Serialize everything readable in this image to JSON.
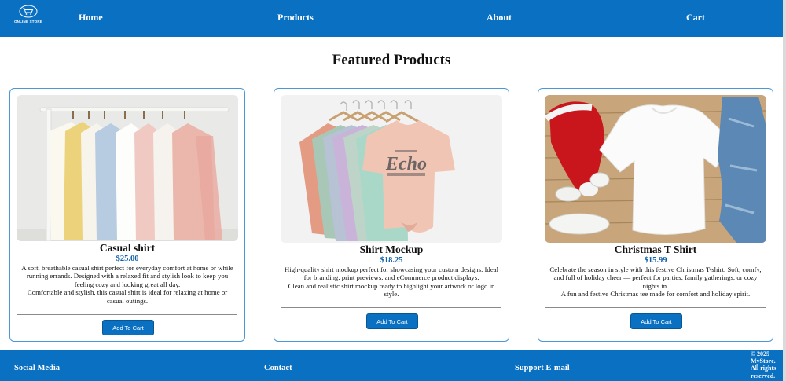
{
  "nav": {
    "logo_text": "ONLINE STORE",
    "links": [
      "Home",
      "Products",
      "About",
      "Cart"
    ]
  },
  "main": {
    "title": "Featured Products"
  },
  "products": [
    {
      "name": "Casual shirt",
      "price": "$25.00",
      "description": "A soft, breathable casual shirt perfect for everyday comfort at home or while running errands. Designed with a relaxed fit and stylish look to keep you feeling cozy and looking great all day.",
      "tagline": "Comfortable and stylish, this casual shirt is ideal for relaxing at home or casual outings.",
      "button": "Add To Cart",
      "image_icon": "shirts-on-rack-photo"
    },
    {
      "name": "Shirt Mockup",
      "price": "$18.25",
      "description": "High-quality shirt mockup perfect for showcasing your custom designs. Ideal for branding, print previews, and eCommerce product displays.",
      "tagline": "Clean and realistic shirt mockup ready to highlight your artwork or logo in style.",
      "button": "Add To Cart",
      "image_icon": "tshirt-mockup-photo",
      "image_print": "Echo"
    },
    {
      "name": "Christmas T Shirt",
      "price": "$15.99",
      "description": "Celebrate the season in style with this festive Christmas T-shirt. Soft, comfy, and full of holiday cheer — perfect for parties, family gatherings, or cozy nights in.",
      "tagline": "A fun and festive Christmas tee made for comfort and holiday spirit.",
      "button": "Add To Cart",
      "image_icon": "christmas-tshirt-flatlay-photo"
    }
  ],
  "footer": {
    "social": "Social Media",
    "contact": "Contact",
    "support": "Support E-mail",
    "copyright": "© 2025 MyStore. All rights reserved."
  },
  "colors": {
    "primary": "#0a70c2",
    "price": "#0d5fa8",
    "card_border": "#4a98d6"
  }
}
